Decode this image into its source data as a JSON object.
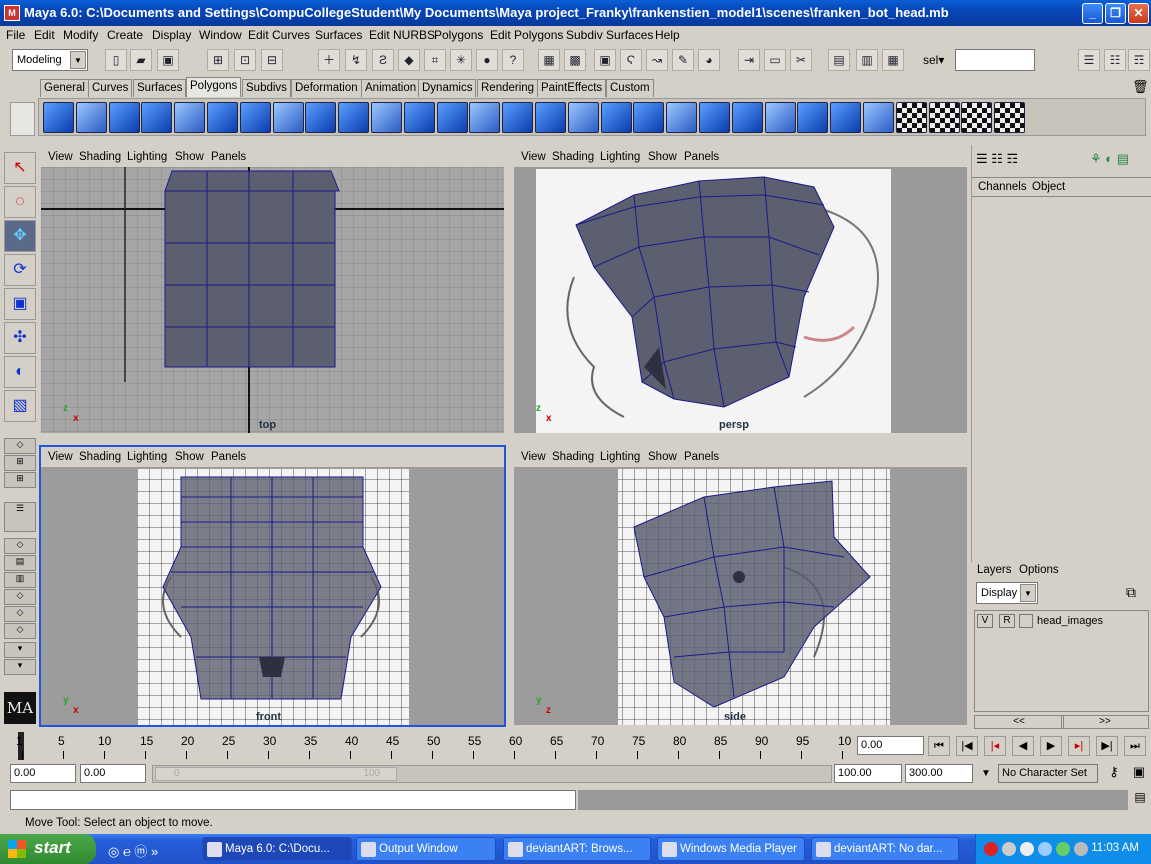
{
  "window": {
    "title": "Maya 6.0: C:\\Documents and Settings\\CompuCollegeStudent\\My Documents\\Maya project_Franky\\frankenstien_model1\\scenes\\franken_bot_head.mb",
    "min": "_",
    "max": "❐",
    "close": "✕"
  },
  "menu": [
    "File",
    "Edit",
    "Modify",
    "Create",
    "Display",
    "Window",
    "Edit Curves",
    "Surfaces",
    "Edit NURBS",
    "Polygons",
    "Edit Polygons",
    "Subdiv Surfaces",
    "Help"
  ],
  "status": {
    "mode": "Modeling",
    "sel_label": "sel▾",
    "sel_value": ""
  },
  "shelf_tabs": [
    "General",
    "Curves",
    "Surfaces",
    "Polygons",
    "Subdivs",
    "Deformation",
    "Animation",
    "Dynamics",
    "Rendering",
    "PaintEffects",
    "Custom"
  ],
  "active_tab": "Polygons",
  "viewport_menu": [
    "View",
    "Shading",
    "Lighting",
    "Show",
    "Panels"
  ],
  "viewports": {
    "top": "top",
    "persp": "persp",
    "front": "front",
    "side": "side"
  },
  "axis_labels": {
    "y": "y",
    "x": "x",
    "z": "z"
  },
  "channel_box": {
    "tabs": [
      "Channels",
      "Object"
    ]
  },
  "layers": {
    "menu": [
      "Layers",
      "Options"
    ],
    "display": "Display",
    "v": "V",
    "r": "R",
    "layer_name": "head_images",
    "nav_left": "<<",
    "nav_right": ">>"
  },
  "timeline": {
    "ticks": [
      "1",
      "5",
      "10",
      "15",
      "20",
      "25",
      "30",
      "35",
      "40",
      "45",
      "50",
      "55",
      "60",
      "65",
      "70",
      "75",
      "80",
      "85",
      "90",
      "95",
      "10"
    ],
    "current": "0.00"
  },
  "range": {
    "start": "0.00",
    "playback_start": "0.00",
    "slider_start": "0",
    "slider_end": "100",
    "playback_end": "100.00",
    "end": "300.00",
    "character_set": "No Character Set"
  },
  "help": "Move Tool: Select an object to move.",
  "taskbar": {
    "start": "start",
    "tasks": [
      "Maya 6.0: C:\\Docu...",
      "Output Window",
      "deviantART: Brows...",
      "Windows Media Player",
      "deviantART: No dar..."
    ],
    "clock": "11:03 AM"
  },
  "colors": {
    "mesh": "#5c5f70",
    "wire": "#1a1a8a",
    "active_border": "#2255dd"
  }
}
